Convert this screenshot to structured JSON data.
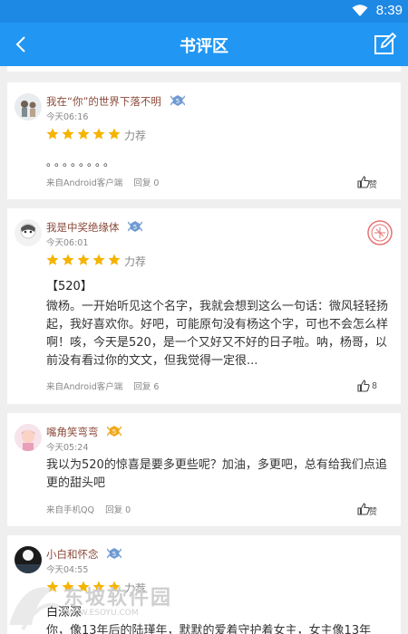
{
  "status": {
    "time": "8:39"
  },
  "appbar": {
    "title": "书评区"
  },
  "reviews": [
    {
      "username": "我在“你”的世界下落不明",
      "time": "今天06:16",
      "rating_text": "力荐",
      "stars": 5,
      "content": "。。。。。。。。",
      "source": "来自Android客户端",
      "reply": "回复 0",
      "like": "赞"
    },
    {
      "username": "我是中奖绝缘体",
      "time": "今天06:01",
      "rating_text": "力荐",
      "stars": 5,
      "title": "【520】",
      "content": "微杨。一开始听见这个名字，我就会想到这么一句话：微风轻轻扬起，我好喜欢你。好吧，可能原句没有杨这个字，可也不会怎么样啊！咳，今天是520，是一个又好又不好的日子啦。呐，杨哥，以前没有看过你的文文，但我觉得一定很...",
      "source": "来自Android客户端",
      "reply": "回复 6",
      "like": "8"
    },
    {
      "username": "嘴角笑弯弯",
      "time": "今天05:24",
      "content": "我以为520的惊喜是要多更些呢？加油，多更吧，总有给我们点追更的甜头吧",
      "source": "来自手机QQ",
      "reply": "回复 0",
      "like": "赞"
    },
    {
      "username": "小白和怀念",
      "time": "今天04:55",
      "rating_text": "力荐",
      "stars": 5,
      "title": "白深深",
      "content": "你，像13年后的陆瑾年，默默的爱着守护着女主，女主像13年"
    }
  ],
  "watermark": {
    "text": "东坡软件园",
    "url": "WWW.ESOYU.COM"
  },
  "colors": {
    "appbar": "#2196f3",
    "statusbar": "#1e88e5",
    "star": "#f5b400",
    "username": "#8b4a3a"
  }
}
